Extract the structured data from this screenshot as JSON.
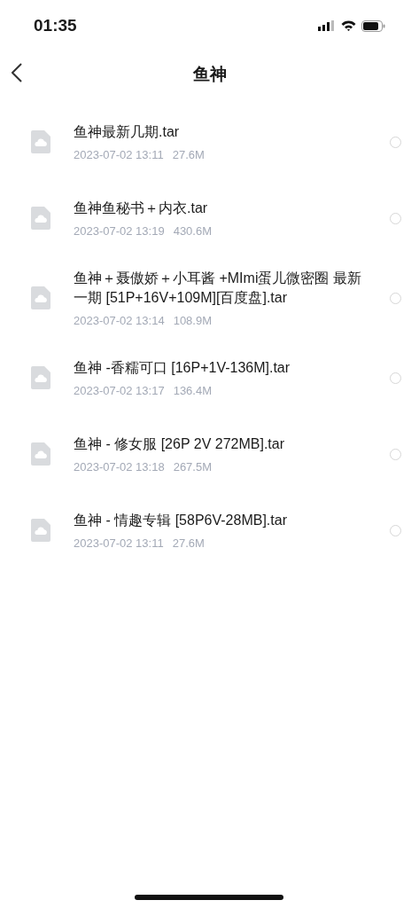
{
  "status_bar": {
    "time": "01:35"
  },
  "nav": {
    "title": "鱼神"
  },
  "files": [
    {
      "name": "鱼神最新几期.tar",
      "date": "2023-07-02 13:11",
      "size": "27.6M",
      "selected": false
    },
    {
      "name": "鱼神鱼秘书＋内衣.tar",
      "date": "2023-07-02 13:19",
      "size": "430.6M",
      "selected": false
    },
    {
      "name": "鱼神＋聂傲娇＋小耳酱 +MImi蛋儿微密圈 最新一期 [51P+16V+109M][百度盘].tar",
      "date": "2023-07-02 13:14",
      "size": "108.9M",
      "selected": false
    },
    {
      "name": "鱼神 -香糯可口 [16P+1V-136M].tar",
      "date": "2023-07-02 13:17",
      "size": "136.4M",
      "selected": false
    },
    {
      "name": "鱼神 - 修女服 [26P 2V 272MB].tar",
      "date": "2023-07-02 13:18",
      "size": "267.5M",
      "selected": false
    },
    {
      "name": "鱼神 - 情趣专辑 [58P6V-28MB].tar",
      "date": "2023-07-02 13:11",
      "size": "27.6M",
      "selected": false
    }
  ]
}
